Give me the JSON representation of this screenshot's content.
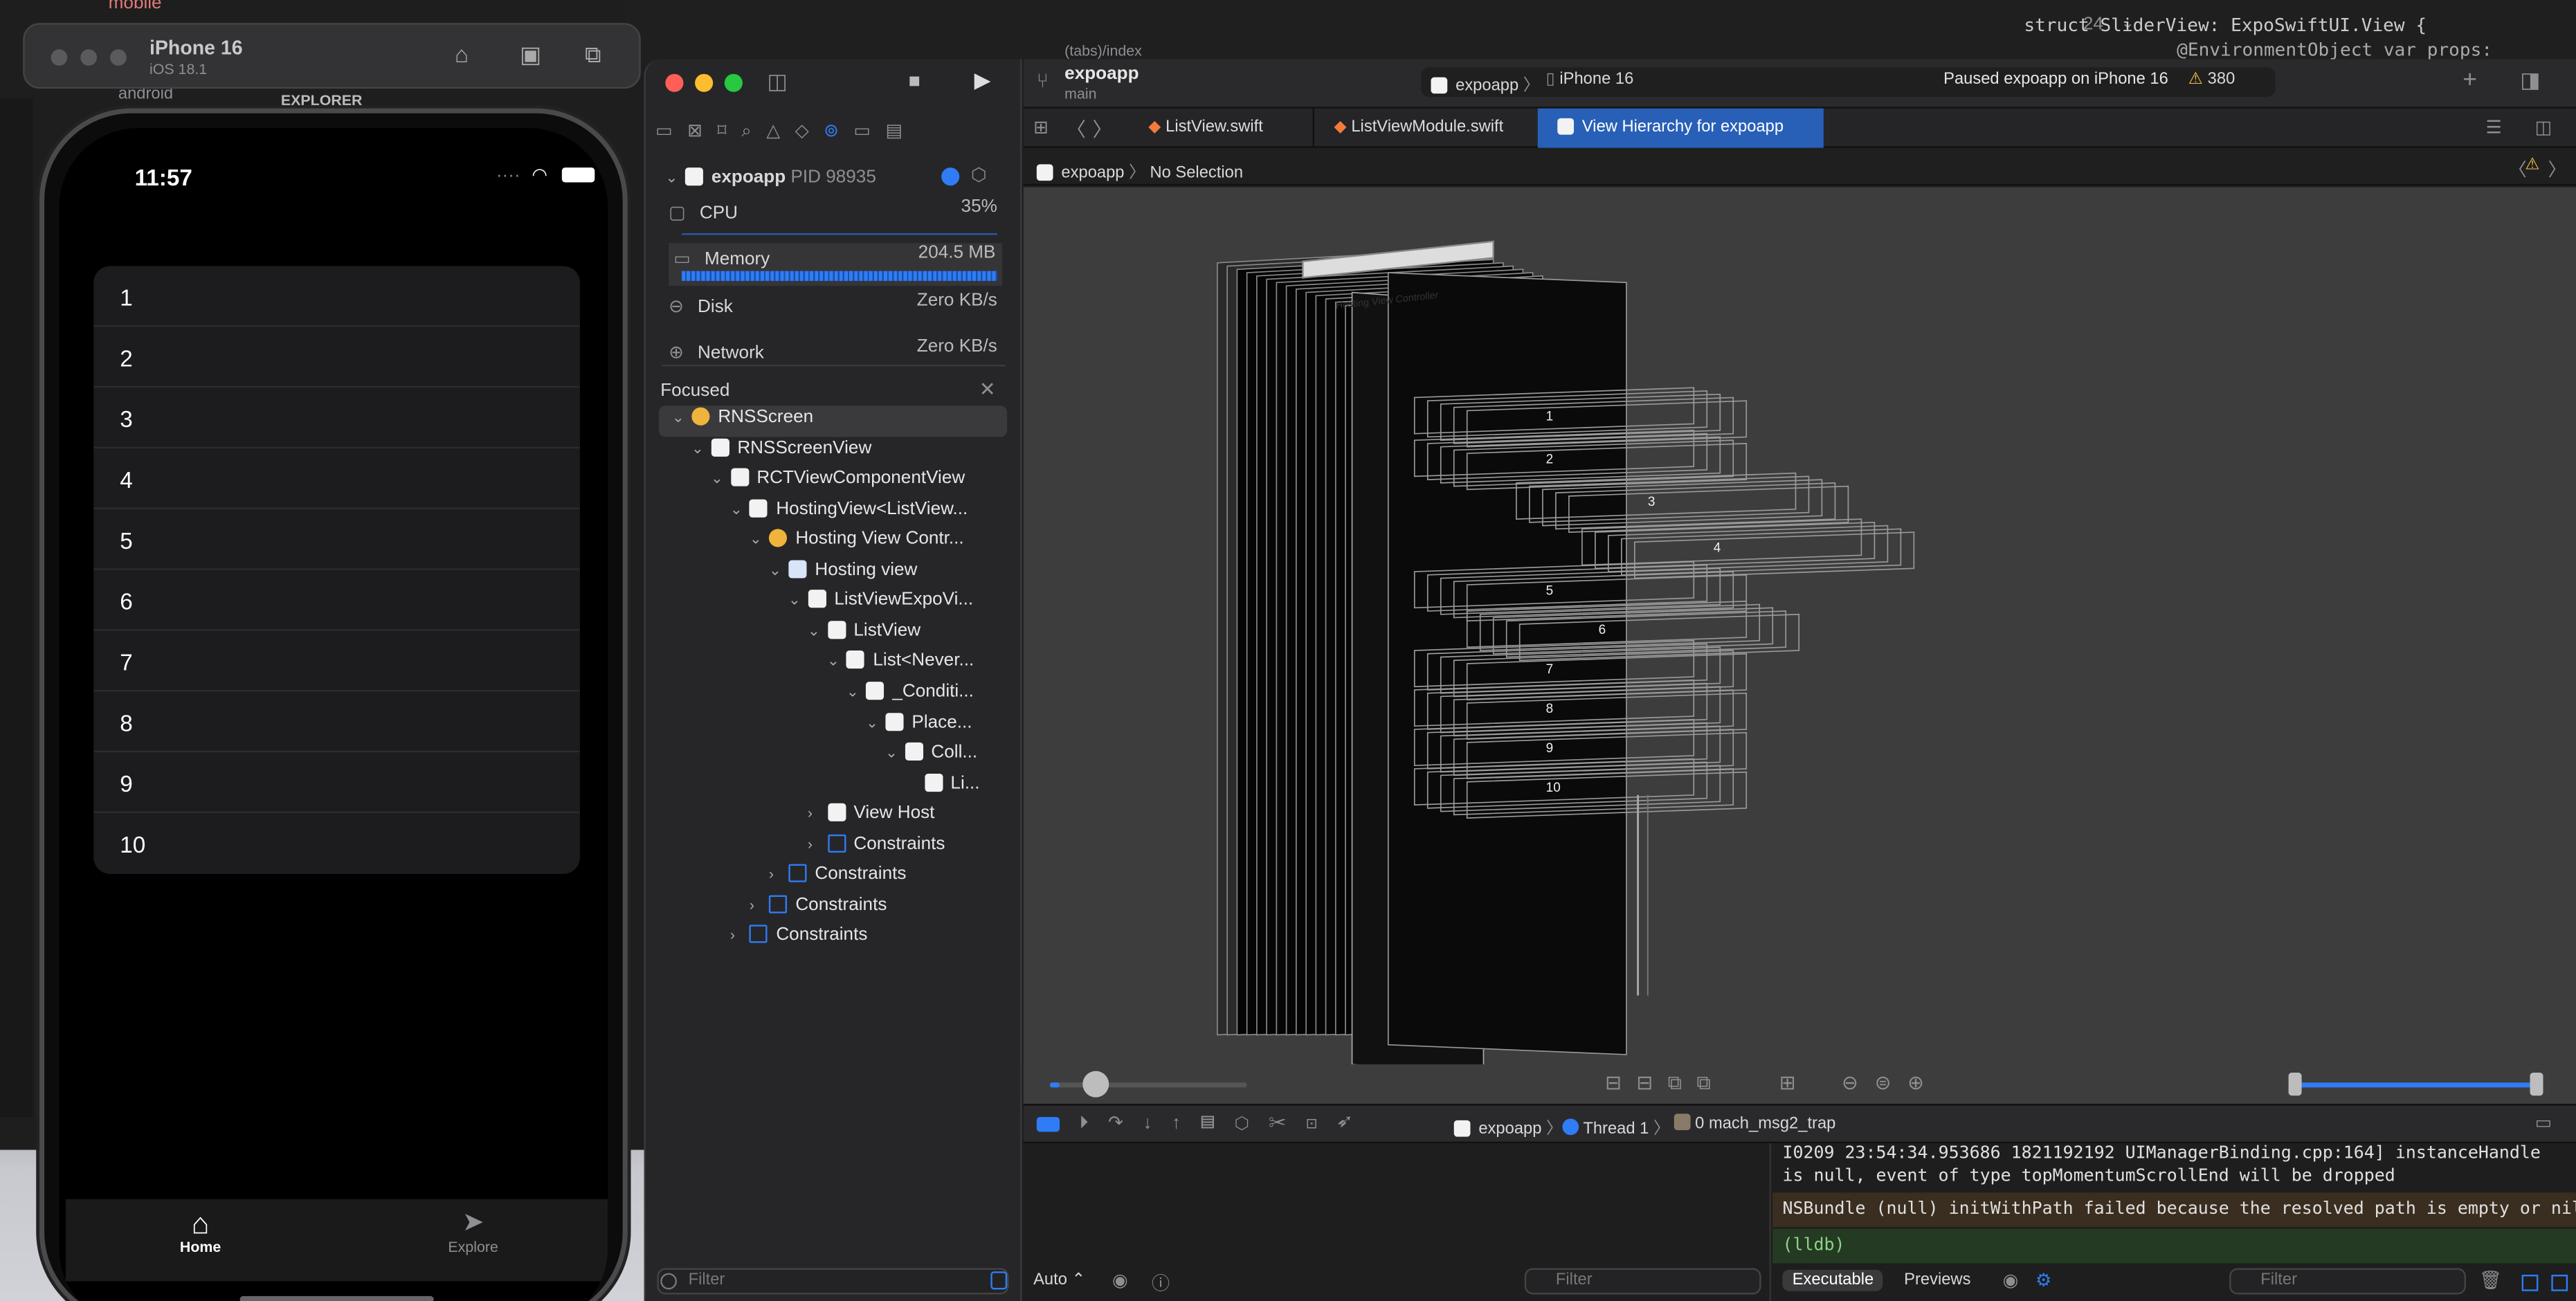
{
  "editor_behind": {
    "line_number": "24",
    "code_line": "struct SliderView: ExpoSwiftUI.View {",
    "code_line_2": "@EnvironmentObject var props: SliderPro",
    "explorer_label": "EXPLORER",
    "folder_label": "mobile",
    "folder_item": "android",
    "tab_hint": "(tabs)/index"
  },
  "simulator": {
    "device_name": "iPhone 16",
    "os_version": "iOS 18.1",
    "time": "11:57",
    "list_items": [
      "1",
      "2",
      "3",
      "4",
      "5",
      "6",
      "7",
      "8",
      "9",
      "10"
    ],
    "tabs": [
      {
        "label": "Home",
        "icon": "house-icon",
        "active": true
      },
      {
        "label": "Explore",
        "icon": "paperplane-icon",
        "active": false
      }
    ]
  },
  "xcode": {
    "project": "expoapp",
    "branch": "main",
    "scheme": "expoapp",
    "destination": "iPhone 16",
    "status": "Paused expoapp on iPhone 16",
    "warning_count": "380",
    "file_tabs": [
      "ListView.swift",
      "ListViewModule.swift",
      "View Hierarchy for expoapp"
    ],
    "jump_bar": [
      "expoapp",
      "No Selection"
    ],
    "debug_nav": {
      "process": "expoapp",
      "pid": "PID 98935",
      "metrics": [
        {
          "label": "CPU",
          "value": "35%"
        },
        {
          "label": "Memory",
          "value": "204.5 MB"
        },
        {
          "label": "Disk",
          "value": "Zero KB/s"
        },
        {
          "label": "Network",
          "value": "Zero KB/s"
        }
      ],
      "memory_fill": 1.0,
      "focused_label": "Focused",
      "filter_placeholder": "Filter"
    },
    "tree": [
      {
        "label": "RNSScreen",
        "depth": 0,
        "icon": "vc",
        "open": true,
        "selected": true
      },
      {
        "label": "RNSScreenView",
        "depth": 1,
        "icon": "view",
        "open": true
      },
      {
        "label": "RCTViewComponentView",
        "depth": 2,
        "icon": "view",
        "open": true
      },
      {
        "label": "HostingView<ListView...",
        "depth": 3,
        "icon": "view",
        "open": true
      },
      {
        "label": "Hosting View Contr...",
        "depth": 4,
        "icon": "vc",
        "open": true
      },
      {
        "label": "Hosting view",
        "depth": 5,
        "icon": "hv",
        "open": true
      },
      {
        "label": "ListViewExpoVi...",
        "depth": 6,
        "icon": "view",
        "open": true
      },
      {
        "label": "ListView",
        "depth": 7,
        "icon": "view",
        "open": true
      },
      {
        "label": "List<Never...",
        "depth": 8,
        "icon": "view",
        "open": true
      },
      {
        "label": "_Conditi...",
        "depth": 9,
        "icon": "view",
        "open": true
      },
      {
        "label": "Place...",
        "depth": 10,
        "icon": "view",
        "open": true
      },
      {
        "label": "Coll...",
        "depth": 11,
        "icon": "view",
        "open": true
      },
      {
        "label": "Li...",
        "depth": 12,
        "icon": "view",
        "open": false,
        "leaf": true
      },
      {
        "label": "View Host",
        "depth": 7,
        "icon": "view",
        "open": false
      },
      {
        "label": "Constraints",
        "depth": 7,
        "icon": "constraint",
        "open": false
      },
      {
        "label": "Constraints",
        "depth": 5,
        "icon": "constraint",
        "open": false
      },
      {
        "label": "Constraints",
        "depth": 4,
        "icon": "constraint",
        "open": false
      },
      {
        "label": "Constraints",
        "depth": 3,
        "icon": "constraint",
        "open": false
      }
    ],
    "hierarchy_labels": [
      "1",
      "2",
      "3",
      "4",
      "5",
      "6",
      "7",
      "8",
      "9",
      "10"
    ],
    "hierarchy_vc_label": "Hosting View Controller",
    "canvas_zoom": 0.05,
    "depth_range": [
      0.0,
      1.0
    ],
    "debug_bar": {
      "process": "expoapp",
      "thread": "Thread 1",
      "frame": "0 mach_msg2_trap"
    },
    "console_lines": [
      {
        "text": "I0209 23:54:34.953686 1821192192 UIManagerBinding.cpp:164] instanceHandle is null, event of type topMomentumScrollEnd will be dropped",
        "style": "normal"
      },
      {
        "text": "NSBundle (null) initWithPath failed because the resolved path is empty or nil",
        "style": "warn"
      },
      {
        "text": "(lldb)",
        "style": "prompt"
      }
    ],
    "vars_mode": "Auto",
    "console_tabs": [
      "Executable",
      "Previews"
    ],
    "filter_placeholder": "Filter"
  },
  "colors": {
    "accent": "#2f7cf6",
    "xcode_bg": "#1f1f1f",
    "warn_row": "#3a2e20",
    "prompt_row": "#243a22"
  }
}
